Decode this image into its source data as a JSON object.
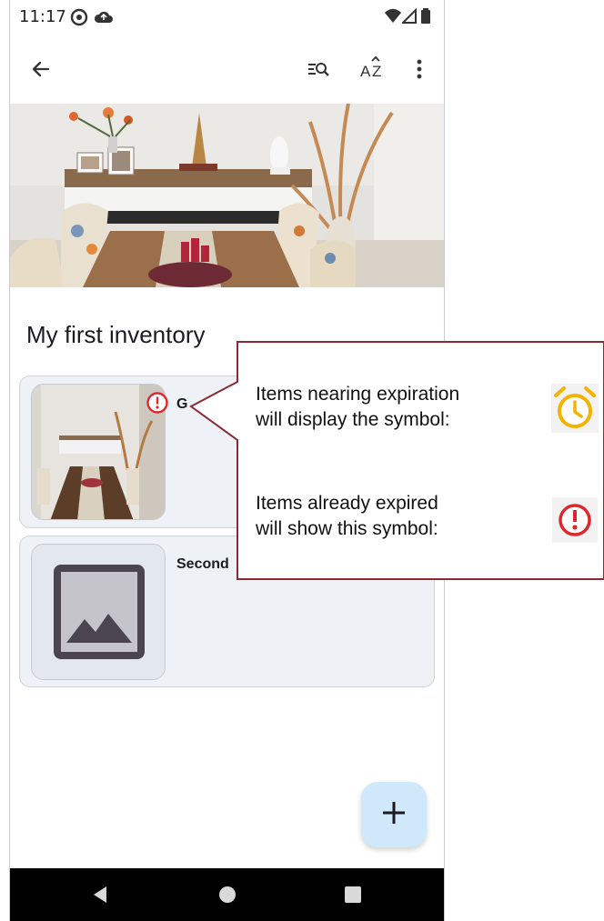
{
  "status_bar": {
    "time": "11:17",
    "icons": [
      "sync-icon",
      "cloud-icon",
      "wifi-icon",
      "signal-icon",
      "battery-icon"
    ]
  },
  "app_bar": {
    "icons": [
      "back-arrow-icon",
      "search-list-icon",
      "sort-az-icon",
      "more-vert-icon"
    ]
  },
  "inventory": {
    "title": "My first inventory",
    "items": [
      {
        "title": "G",
        "status": "expired"
      },
      {
        "title": "Second",
        "status": "none"
      }
    ]
  },
  "fab": {
    "icon": "plus-icon"
  },
  "tooltip": {
    "nearing_line1": "Items nearing expiration",
    "nearing_line2": "will display the symbol:",
    "expired_line1": "Items already expired",
    "expired_line2": "will show this symbol:",
    "nearing_icon": "alarm-clock-icon",
    "expired_icon": "expired-alert-icon"
  },
  "colors": {
    "expired": "#e0262b",
    "nearing": "#f5b300",
    "fab": "#cfe9fb",
    "callout_border": "#8a2a33"
  }
}
